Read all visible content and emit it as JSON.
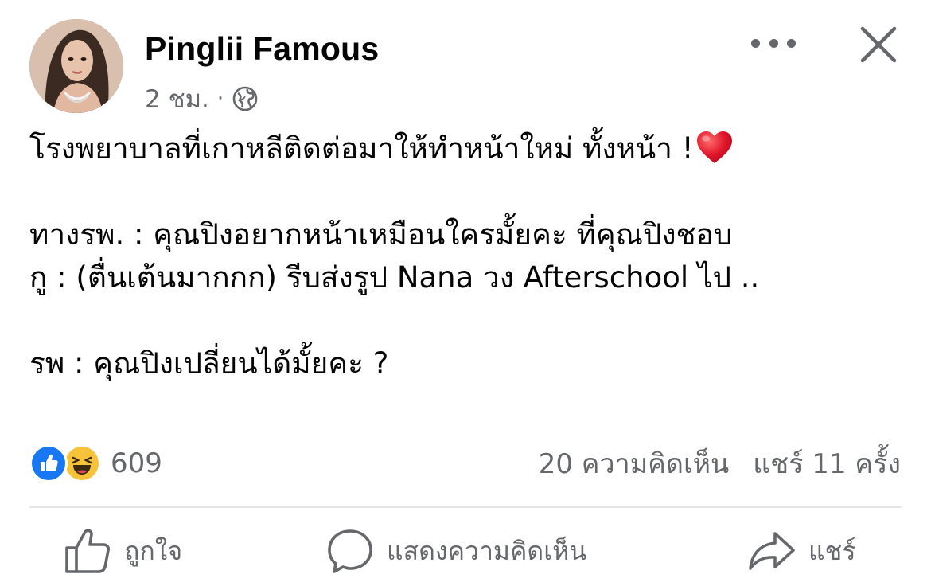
{
  "post": {
    "author": "Pinglii Famous",
    "time": "2 ชม.",
    "separator": "·",
    "privacy_icon": "globe-icon",
    "more_icon": "more-horizontal-icon",
    "close_icon": "close-icon",
    "body": {
      "line1": "โรงพยาบาลที่เกาหลีติดต่อมาให้ทำหน้าใหม่ ทั้งหน้า !",
      "line1_emoji": "red-heart-icon",
      "line2": "ทางรพ. : คุณปิงอยากหน้าเหมือนใครมั้ยคะ ที่คุณปิงชอบ",
      "line3": "กู : (ตื่นเต้นมากกก) รีบส่งรูป Nana วง Afterschool ไป ..",
      "line4": "รพ : คุณปิงเปลี่ยนได้มั้ยคะ ?"
    },
    "stats": {
      "reactions": [
        "like-reaction-icon",
        "haha-reaction-icon"
      ],
      "reaction_count": "609",
      "comments": "20 ความคิดเห็น",
      "shares": "แชร์ 11 ครั้ง"
    },
    "actions": {
      "like": "ถูกใจ",
      "comment": "แสดงความคิดเห็น",
      "share": "แชร์"
    }
  },
  "colors": {
    "text_primary": "#050505",
    "text_secondary": "#65676b",
    "like_blue": "#1877f2",
    "haha_yellow": "#f7c33b",
    "heart_red": "#e0162b",
    "divider": "#e4e6eb"
  }
}
